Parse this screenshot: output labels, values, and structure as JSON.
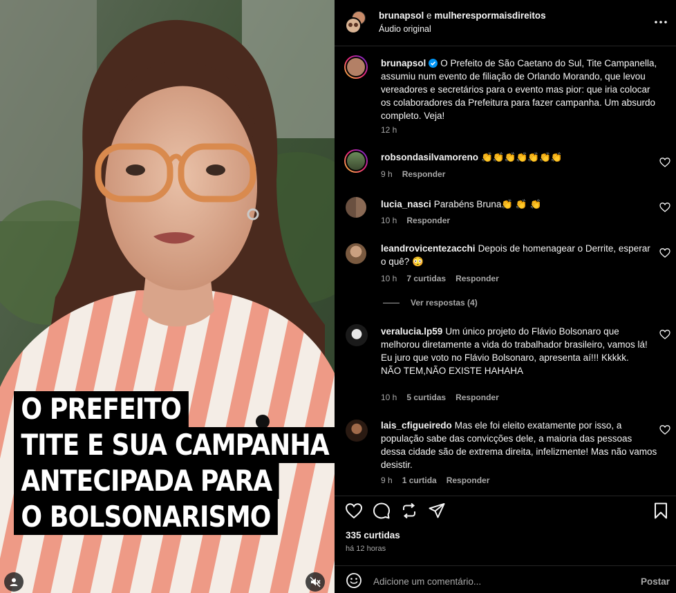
{
  "media": {
    "caption_lines": [
      "O PREFEITO",
      "TITE E SUA CAMPANHA",
      "ANTECIPADA PARA",
      "O BOLSONARISMO"
    ],
    "mute_icon": "speaker-muted-icon",
    "user_tag_icon": "user-icon"
  },
  "header": {
    "user1": "brunapsol",
    "joiner": "e",
    "user2": "mulherespormaisdireitos",
    "audio": "Áudio original"
  },
  "caption": {
    "user": "brunapsol",
    "text": "O Prefeito de São Caetano do Sul, Tite Campanella, assumiu num evento de filiação de Orlando Morando, que levou vereadores e secretários para o evento mas pior: que iria colocar os colaboradores da Prefeitura para fazer campanha. Um absurdo completo. Veja!",
    "time": "12 h"
  },
  "comments": [
    {
      "user": "robsondasilvamoreno",
      "text": "👏👏👏👏👏👏👏",
      "time": "9 h",
      "likes": "",
      "reply": "Responder"
    },
    {
      "user": "lucia_nasci",
      "text": "Parabéns Bruna👏 👏 👏",
      "time": "10 h",
      "likes": "",
      "reply": "Responder"
    },
    {
      "user": "leandrovicentezacchi",
      "text": "Depois de homenagear o Derrite, esperar o quê? 😳",
      "time": "10 h",
      "likes": "7 curtidas",
      "reply": "Responder"
    },
    {
      "user": "veralucia.lp59",
      "text": "Um único projeto do Flávio Bolsonaro que melhorou diretamente a vida do trabalhador brasileiro, vamos lá!",
      "text2": "Eu juro que voto no Flávio Bolsonaro, apresenta aí!!! Kkkkk.",
      "text3": "NÃO TEM,NÃO EXISTE HAHAHA",
      "time": "10 h",
      "likes": "5 curtidas",
      "reply": "Responder"
    },
    {
      "user": "lais_cfigueiredo",
      "text": "Mas ele foi eleito exatamente por isso, a população sabe das convicções dele, a maioria das pessoas dessa cidade são de extrema direita, infelizmente! Mas não vamos desistir.",
      "time": "9 h",
      "likes": "1 curtida",
      "reply": "Responder"
    }
  ],
  "view_replies": "Ver respostas (4)",
  "stats": {
    "likes": "335 curtidas",
    "time_ago": "há 12 horas"
  },
  "composer": {
    "placeholder": "Adicione um comentário...",
    "post": "Postar"
  },
  "colors": {
    "verified": "#0095f6",
    "muted_text": "#a8a8a8",
    "background": "#000000"
  }
}
